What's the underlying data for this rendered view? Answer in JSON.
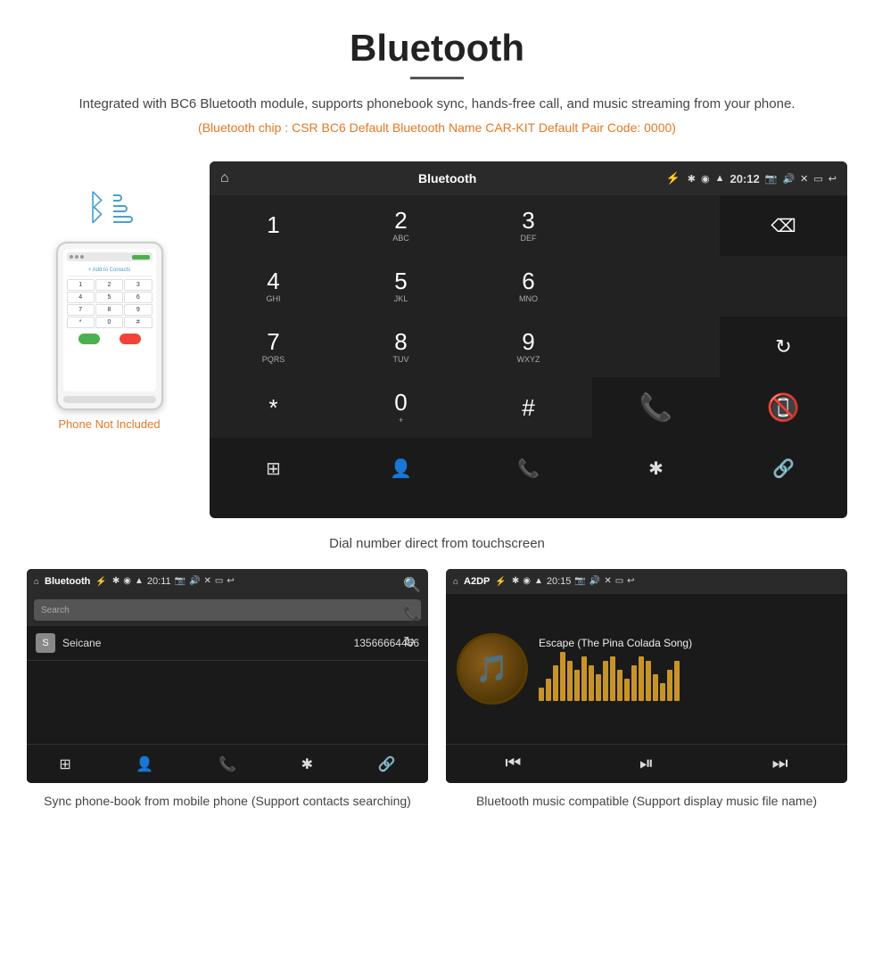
{
  "page": {
    "title": "Bluetooth",
    "description": "Integrated with BC6 Bluetooth module, supports phonebook sync, hands-free call, and music streaming from your phone.",
    "spec_line": "(Bluetooth chip : CSR BC6    Default Bluetooth Name CAR-KIT    Default Pair Code: 0000)",
    "caption_main": "Dial number direct from touchscreen",
    "caption_left": "Sync phone-book from mobile phone\n(Support contacts searching)",
    "caption_right": "Bluetooth music compatible\n(Support display music file name)"
  },
  "car_screen": {
    "title": "Bluetooth",
    "time": "20:12",
    "dialpad": {
      "keys": [
        {
          "num": "1",
          "letters": ""
        },
        {
          "num": "2",
          "letters": "ABC"
        },
        {
          "num": "3",
          "letters": "DEF"
        },
        {
          "num": "4",
          "letters": "GHI"
        },
        {
          "num": "5",
          "letters": "JKL"
        },
        {
          "num": "6",
          "letters": "MNO"
        },
        {
          "num": "7",
          "letters": "PQRS"
        },
        {
          "num": "8",
          "letters": "TUV"
        },
        {
          "num": "9",
          "letters": "WXYZ"
        },
        {
          "num": "*",
          "letters": ""
        },
        {
          "num": "0",
          "letters": "+"
        },
        {
          "num": "#",
          "letters": ""
        }
      ]
    }
  },
  "phonebook_screen": {
    "title": "Bluetooth",
    "time": "20:11",
    "search_placeholder": "Search",
    "contacts": [
      {
        "letter": "S",
        "name": "Seicane",
        "number": "13566664466"
      }
    ]
  },
  "music_screen": {
    "title": "A2DP",
    "time": "20:15",
    "song": "Escape (The Pina Colada Song)",
    "viz_bars": [
      15,
      25,
      40,
      55,
      45,
      35,
      50,
      40,
      30,
      45,
      50,
      35,
      25,
      40,
      50,
      45,
      30,
      20,
      35,
      45
    ]
  },
  "phone_labels": {
    "not_included": "Phone Not Included"
  },
  "icons": {
    "home": "⌂",
    "usb": "⚓",
    "bluetooth": "✱",
    "location": "◉",
    "wifi": "▲",
    "camera": "📷",
    "volume": "🔊",
    "close": "✕",
    "window": "▭",
    "back": "↩",
    "delete": "⌫",
    "refresh": "↻",
    "call_green": "📞",
    "call_red": "📵",
    "grid": "⋮⋮",
    "person": "👤",
    "phone": "📞",
    "bt": "✱",
    "link": "🔗",
    "search": "🔍",
    "prev": "⏮",
    "play": "⏯",
    "next": "⏭"
  }
}
